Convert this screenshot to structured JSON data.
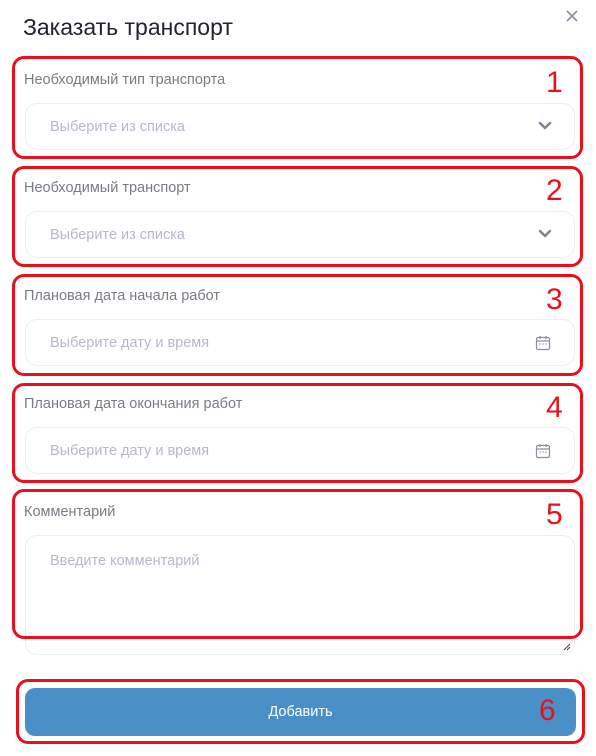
{
  "modal": {
    "title": "Заказать транспорт"
  },
  "fields": [
    {
      "label": "Необходимый тип транспорта",
      "placeholder": "Выберите из списка",
      "icon": "chevron-down-icon",
      "marker": "1"
    },
    {
      "label": "Необходимый транспорт",
      "placeholder": "Выберите из списка",
      "icon": "chevron-down-icon",
      "marker": "2"
    },
    {
      "label": "Плановая дата начала работ",
      "placeholder": "Выберите дату и время",
      "icon": "calendar-icon",
      "marker": "3"
    },
    {
      "label": "Плановая дата окончания работ",
      "placeholder": "Выберите дату и время",
      "icon": "calendar-icon",
      "marker": "4"
    },
    {
      "label": "Комментарий",
      "placeholder": "Введите комментарий",
      "marker": "5"
    }
  ],
  "submit": {
    "label": "Добавить",
    "marker": "6"
  },
  "colors": {
    "accent": "#4a90c7",
    "marker": "#e8101a",
    "placeholder": "#b6b8cc",
    "label": "#7b7b86"
  }
}
